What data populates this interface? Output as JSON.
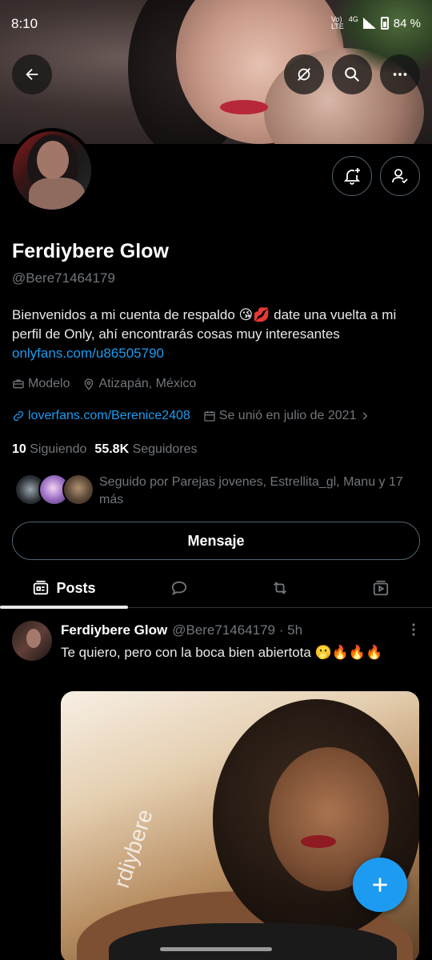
{
  "status_bar": {
    "time": "8:10",
    "network_top": "Vo)",
    "network_bottom": "LTE",
    "network_type": "4G",
    "battery": "84 %"
  },
  "profile": {
    "name": "Ferdiybere Glow",
    "handle": "@Bere71464179",
    "bio": "Bienvenidos a mi cuenta de respaldo 😘💋 date una vuelta a mi perfil de Only, ahí encontrarás cosas muy interesantes",
    "bio_link": "onlyfans.com/u86505790",
    "profession": "Modelo",
    "location": "Atizapán, México",
    "website": "loverfans.com/Berenice2408",
    "joined": "Se unió en julio de 2021",
    "following_count": "10",
    "following_label": "Siguiendo",
    "followers_count": "55.8K",
    "followers_label": "Seguidores",
    "followed_by": "Seguido por Parejas jovenes, Estrellita_gl, Manu y 17 más",
    "message_button": "Mensaje"
  },
  "tabs": {
    "posts": "Posts"
  },
  "post": {
    "name": "Ferdiybere Glow",
    "handle_time": "@Bere71464179 · 5h",
    "text": "Te quiero, pero con la boca bien abiertota 🫢🔥🔥🔥",
    "image_watermark": "rdiybere"
  },
  "colors": {
    "accent": "#1d9bf0",
    "background": "#000000",
    "muted": "#71767b"
  },
  "icons": [
    "back-arrow-icon",
    "vpn-icon",
    "search-icon",
    "more-icon",
    "bell-plus-icon",
    "person-check-icon",
    "briefcase-icon",
    "location-pin-icon",
    "link-icon",
    "calendar-icon",
    "chevron-right-icon",
    "posts-icon",
    "reply-icon",
    "repost-icon",
    "media-icon",
    "plus-icon"
  ]
}
